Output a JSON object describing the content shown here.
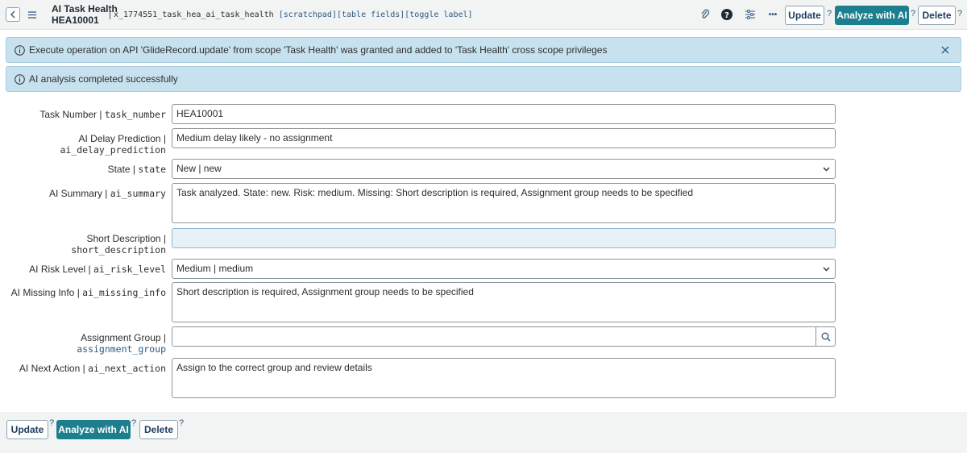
{
  "header": {
    "title_line1": "AI Task Health",
    "title_line2": "HEA10001",
    "table_name": "x_1774551_task_hea_ai_task_health",
    "tags": "[scratchpad][table fields][toggle label]",
    "buttons": {
      "update": "Update",
      "analyze": "Analyze with AI",
      "delete": "Delete",
      "help": "?",
      "more": "•••"
    }
  },
  "banners": [
    {
      "text": "Execute operation on API 'GlideRecord.update' from scope 'Task Health' was granted and added to 'Task Health' cross scope privileges"
    },
    {
      "text": "AI analysis completed successfully"
    }
  ],
  "form": {
    "task_number": {
      "label": "Task Number | ",
      "field": "task_number",
      "value": "HEA10001"
    },
    "ai_delay_prediction": {
      "label": "AI Delay Prediction |",
      "field": "ai_delay_prediction",
      "value": "Medium delay likely - no assignment"
    },
    "state": {
      "label": "State | ",
      "field": "state",
      "value": "New | new"
    },
    "ai_summary": {
      "label": "AI Summary | ",
      "field": "ai_summary",
      "value": "Task analyzed. State: new. Risk: medium. Missing: Short description is required, Assignment group needs to be specified"
    },
    "short_description": {
      "label": "Short Description |",
      "field": "short_description",
      "value": ""
    },
    "ai_risk_level": {
      "label": "AI Risk Level | ",
      "field": "ai_risk_level",
      "value": "Medium | medium"
    },
    "ai_missing_info": {
      "label": "AI Missing Info | ",
      "field": "ai_missing_info",
      "value": "Short description is required, Assignment group needs to be specified"
    },
    "assignment_group": {
      "label": "Assignment Group |",
      "field": "assignment_group",
      "value": ""
    },
    "ai_next_action": {
      "label": "AI Next Action | ",
      "field": "ai_next_action",
      "value": "Assign to the correct group and review details"
    }
  },
  "footer": {
    "update": "Update",
    "analyze": "Analyze with AI",
    "delete": "Delete",
    "help": "?"
  },
  "colors": {
    "primary": "#1d7f8e",
    "banner": "#c7e1ef",
    "link": "#2e5a82"
  }
}
